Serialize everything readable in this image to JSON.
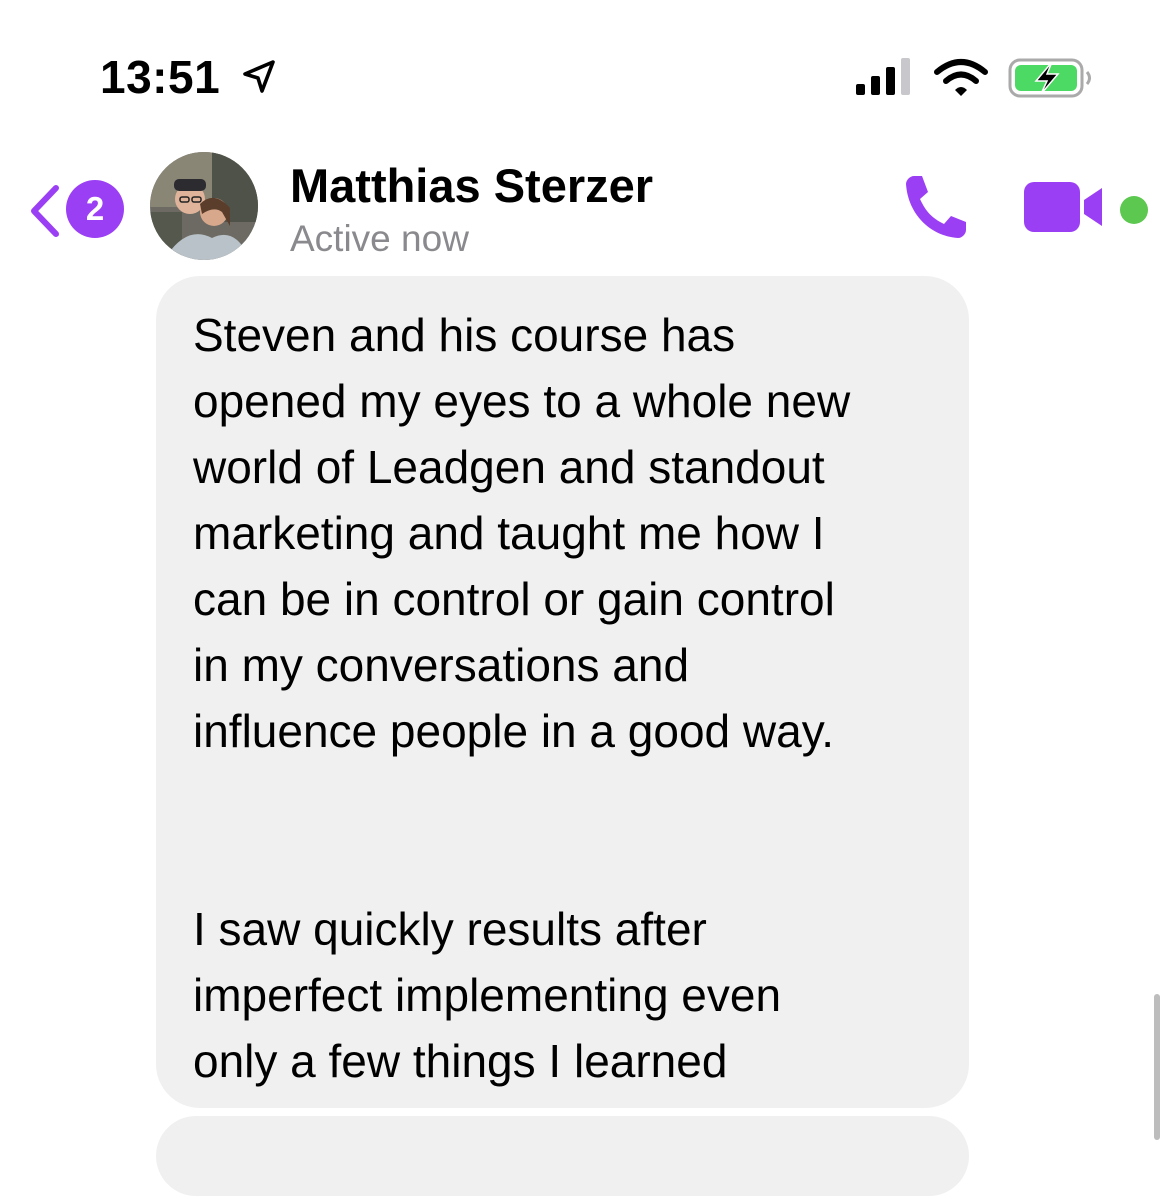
{
  "status_bar": {
    "time": "13:51",
    "location_icon": "location-arrow-icon",
    "signal_icon": "cellular-signal-icon",
    "wifi_icon": "wifi-icon",
    "battery_icon": "battery-charging-icon",
    "battery_color": "#4cd964"
  },
  "header": {
    "back_icon": "chevron-left-icon",
    "unread_count": "2",
    "contact_name": "Matthias Sterzer",
    "contact_status": "Active now",
    "call_icon": "phone-icon",
    "video_icon": "video-camera-icon",
    "accent_color": "#9b3ff5",
    "online_color": "#5cc84f"
  },
  "messages": [
    {
      "text": "Steven and his course has\nopened my eyes to a whole new\nworld of Leadgen and standout\nmarketing and taught me how I\ncan be in control or gain control\nin my conversations and\ninfluence people in a good way.\n\n\nI saw quickly results after\nimperfect implementing even\nonly a few things I learned"
    }
  ]
}
